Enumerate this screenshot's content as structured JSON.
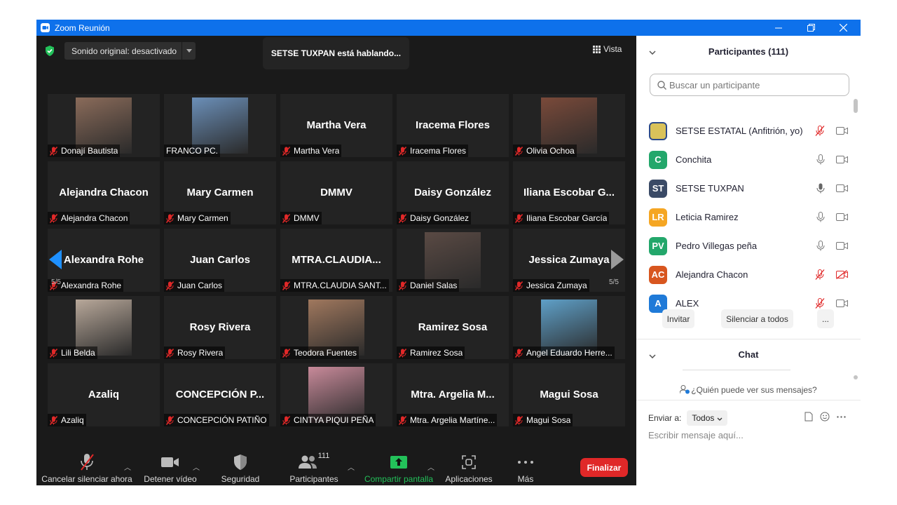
{
  "window": {
    "title": "Zoom Reunión"
  },
  "meeting": {
    "sound_original": "Sonido original: desactivado",
    "speaking_banner": "SETSE TUXPAN está hablando...",
    "view_label": "Vista",
    "page_left": "5/5",
    "page_right": "5/5"
  },
  "tiles": [
    {
      "label": "Donají Bautista",
      "big": "",
      "photo": "photo-woman-1",
      "photo_color": "#8a6b5a"
    },
    {
      "label": "FRANCO PC.",
      "big": "",
      "photo": "photo-town-plaza",
      "photo_color": "#6b8fb8"
    },
    {
      "label": "Martha Vera",
      "big": "Martha Vera",
      "photo": ""
    },
    {
      "label": "Iracema Flores",
      "big": "Iracema Flores",
      "photo": ""
    },
    {
      "label": "Olivia Ochoa",
      "big": "",
      "photo": "photo-woman-2",
      "photo_color": "#7a4a3a"
    },
    {
      "label": "Alejandra Chacon",
      "big": "Alejandra Chacon",
      "photo": ""
    },
    {
      "label": "Mary Carmen",
      "big": "Mary Carmen",
      "photo": ""
    },
    {
      "label": "DMMV",
      "big": "DMMV",
      "photo": ""
    },
    {
      "label": "Daisy González",
      "big": "Daisy González",
      "photo": ""
    },
    {
      "label": "Iliana Escobar García",
      "big": "Iliana  Escobar  G...",
      "photo": ""
    },
    {
      "label": "Alexandra Rohe",
      "big": "Alexandra Rohe",
      "photo": ""
    },
    {
      "label": "Juan Carlos",
      "big": "Juan Carlos",
      "photo": ""
    },
    {
      "label": "MTRA.CLAUDIA SANT...",
      "big": "MTRA.CLAUDIA...",
      "photo": ""
    },
    {
      "label": "Daniel Salas",
      "big": "",
      "photo": "photo-couple",
      "photo_color": "#5a4a44"
    },
    {
      "label": "Jessica Zumaya",
      "big": "Jessica Zumaya",
      "photo": ""
    },
    {
      "label": "Lili Belda",
      "big": "",
      "photo": "photo-woman-3",
      "photo_color": "#b8a89a"
    },
    {
      "label": "Rosy Rivera",
      "big": "Rosy Rivera",
      "photo": ""
    },
    {
      "label": "Teodora Fuentes",
      "big": "",
      "photo": "photo-woman-4",
      "photo_color": "#a0785e"
    },
    {
      "label": "Ramirez Sosa",
      "big": "Ramirez Sosa",
      "photo": ""
    },
    {
      "label": "Angel Eduardo Herre...",
      "big": "",
      "photo": "photo-beach",
      "photo_color": "#5fa0c8"
    },
    {
      "label": "Azaliq",
      "big": "Azaliq",
      "photo": ""
    },
    {
      "label": "CONCEPCIÓN PATIÑO",
      "big": "CONCEPCIÓN  P...",
      "photo": ""
    },
    {
      "label": "CINTYA PIQUI PEÑA",
      "big": "",
      "photo": "photo-woman-5",
      "photo_color": "#c88a9a"
    },
    {
      "label": "Mtra. Argelia Martíne...",
      "big": "Mtra.  Argelia  M...",
      "photo": ""
    },
    {
      "label": "Magui Sosa",
      "big": "Magui Sosa",
      "photo": ""
    }
  ],
  "toolbar": {
    "unmute": "Cancelar silenciar ahora",
    "stop_video": "Detener vídeo",
    "security": "Seguridad",
    "participants": "Participantes",
    "participants_count": "111",
    "share": "Compartir pantalla",
    "apps": "Aplicaciones",
    "more": "Más",
    "end": "Finalizar"
  },
  "panel": {
    "participants_title": "Participantes (111)",
    "search_placeholder": "Buscar un participante",
    "invite": "Invitar",
    "mute_all": "Silenciar a todos",
    "more": "...",
    "chat_title": "Chat",
    "who_can_see": "¿Quién puede ver sus mensajes?",
    "send_to": "Enviar a:",
    "send_to_value": "Todos",
    "message_placeholder": "Escribir mensaje aquí...",
    "participants": [
      {
        "initials": "",
        "name": "SETSE ESTATAL (Anfitrión, yo)",
        "color": "#d9c25a",
        "mic": "muted",
        "video": "on"
      },
      {
        "initials": "C",
        "name": "Conchita",
        "color": "#23a76b",
        "mic": "on",
        "video": "on"
      },
      {
        "initials": "ST",
        "name": "SETSE TUXPAN",
        "color": "#3a4a66",
        "mic": "speaking",
        "video": "on"
      },
      {
        "initials": "LR",
        "name": "Leticia Ramirez",
        "color": "#f5a623",
        "mic": "on",
        "video": "on"
      },
      {
        "initials": "PV",
        "name": "Pedro Villegas peña",
        "color": "#23a76b",
        "mic": "on",
        "video": "on"
      },
      {
        "initials": "AC",
        "name": "Alejandra Chacon",
        "color": "#d8561f",
        "mic": "muted",
        "video": "off"
      },
      {
        "initials": "A",
        "name": "ALEX",
        "color": "#1f7ad8",
        "mic": "muted",
        "video": "on"
      }
    ]
  },
  "colors": {
    "title_bar": "#0e71eb",
    "end_button": "#e02828",
    "share_green": "#23c15a",
    "muted_red": "#e02828"
  }
}
